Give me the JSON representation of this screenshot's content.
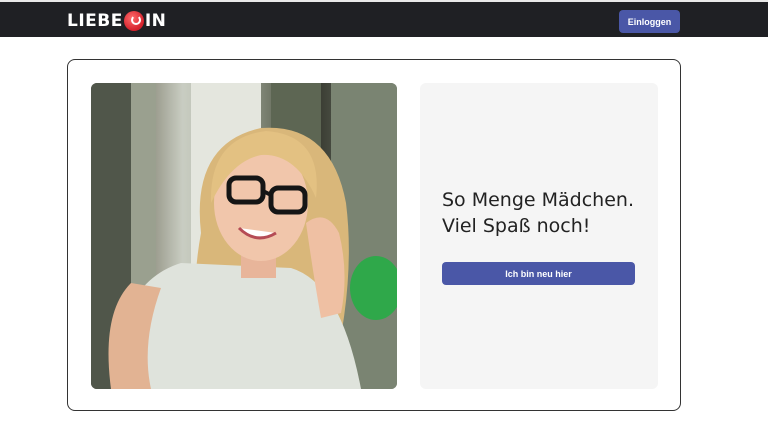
{
  "header": {
    "logo_left": "LIEBE",
    "logo_right": "IN",
    "logo_mark_icon": "power-heart-icon",
    "login_label": "Einloggen"
  },
  "hero": {
    "photo_description_icon": "woman-photo",
    "headline_line1": "So Menge Mädchen.",
    "headline_line2": "Viel Spaß noch!",
    "cta_label": "Ich bin neu hier"
  },
  "colors": {
    "topbar": "#1f2024",
    "accent": "#4a57a7",
    "panel": "#f5f5f5"
  }
}
